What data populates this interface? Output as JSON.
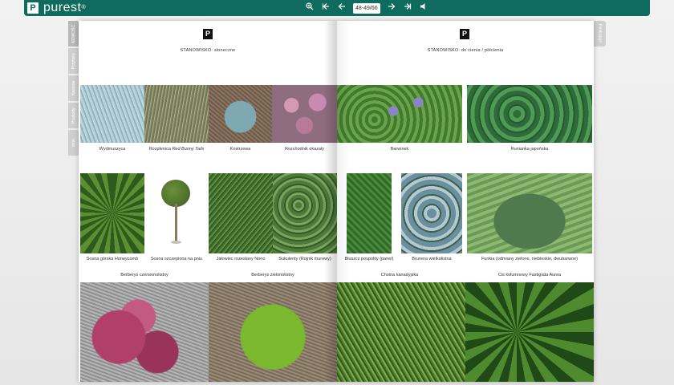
{
  "toolbar": {
    "logo_mark": "P",
    "logo_text": "purest",
    "logo_sup": "®",
    "page_indicator": "48-49/66",
    "icons": [
      "zoom-in-icon",
      "first-page-icon",
      "prev-page-icon",
      "next-page-icon",
      "last-page-icon",
      "sound-icon"
    ]
  },
  "side_tabs": {
    "left": [
      "NOWOŚĆ",
      "Przybory",
      "Nasiona",
      "Produkty",
      "Inne"
    ],
    "right": [
      "Realizacje"
    ]
  },
  "left_page": {
    "header": "STANOWISKO: słoneczne",
    "row1": [
      "Wydmuszyca",
      "Rozplenica",
      "Red Bunny Tails",
      "Kostrzewa",
      "Rozchodnik okazały"
    ],
    "row2": [
      "Sosna górska",
      "Honeycomb",
      "Sosna szczepiona na pniu",
      "Jałowiec rozesłany Nono",
      "Sukulenty (Rojnik murowy)"
    ],
    "row3_captions": [
      "Berberys czerwonolistny",
      "Berberys zielonolistny"
    ]
  },
  "right_page": {
    "header": "STANOWISKO: do cienia / półcienia",
    "row1": [
      "Barwinek",
      "Runianka japońska"
    ],
    "row2": [
      "Bluszcz pospolity (panel)",
      "Brunera wielkolistna",
      "Funkia (odmiany zielone, niebieskie, dwubarwne)"
    ],
    "row3_captions": [
      "Choina kanadyjska",
      "Cis kolumnowy Fastigiata Aurea"
    ]
  }
}
